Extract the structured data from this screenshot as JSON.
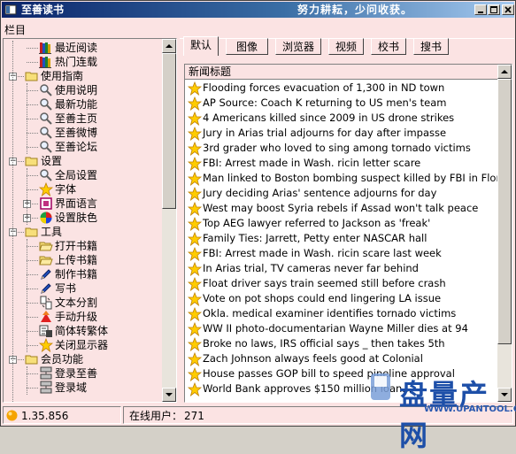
{
  "window": {
    "title": "至善读书",
    "slogan": "努力耕耘，少问收获。",
    "icons": {
      "app": "book-app-icon",
      "minimize": "minimize-icon",
      "maximize": "maximize-icon",
      "close": "close-icon"
    }
  },
  "sidebar": {
    "label": "栏目",
    "items": [
      {
        "label": "最近阅读",
        "icon": "book-stack-icon",
        "level": 1
      },
      {
        "label": "热门连载",
        "icon": "book-stack-icon",
        "level": 1
      },
      {
        "label": "使用指南",
        "icon": "folder-icon",
        "level": 0,
        "expanded": true
      },
      {
        "label": "使用说明",
        "icon": "magnifier-icon",
        "level": 1
      },
      {
        "label": "最新功能",
        "icon": "magnifier-icon",
        "level": 1
      },
      {
        "label": "至善主页",
        "icon": "magnifier-icon",
        "level": 1
      },
      {
        "label": "至善微博",
        "icon": "magnifier-icon",
        "level": 1
      },
      {
        "label": "至善论坛",
        "icon": "magnifier-icon",
        "level": 1
      },
      {
        "label": "设置",
        "icon": "folder-icon",
        "level": 0,
        "expanded": true
      },
      {
        "label": "全局设置",
        "icon": "magnifier-icon",
        "level": 1
      },
      {
        "label": "字体",
        "icon": "star-icon",
        "level": 1
      },
      {
        "label": "界面语言",
        "icon": "frame-icon",
        "level": 1,
        "collapsed": true
      },
      {
        "label": "设置肤色",
        "icon": "color-wheel-icon",
        "level": 1,
        "collapsed": true
      },
      {
        "label": "工具",
        "icon": "folder-icon",
        "level": 0,
        "expanded": true
      },
      {
        "label": "打开书籍",
        "icon": "open-folder-icon",
        "level": 1
      },
      {
        "label": "上传书籍",
        "icon": "open-folder-icon",
        "level": 1
      },
      {
        "label": "制作书籍",
        "icon": "pencil-icon",
        "level": 1
      },
      {
        "label": "写书",
        "icon": "pencil-icon",
        "level": 1
      },
      {
        "label": "文本分割",
        "icon": "split-icon",
        "level": 1
      },
      {
        "label": "手动升级",
        "icon": "upgrade-icon",
        "level": 1
      },
      {
        "label": "简体转繁体",
        "icon": "convert-icon",
        "level": 1
      },
      {
        "label": "关闭显示器",
        "icon": "star-icon",
        "level": 1
      },
      {
        "label": "会员功能",
        "icon": "folder-icon",
        "level": 0,
        "expanded": true
      },
      {
        "label": "登录至善",
        "icon": "network-icon",
        "level": 1
      },
      {
        "label": "登录域",
        "icon": "network-icon",
        "level": 1
      }
    ]
  },
  "tabs": [
    {
      "label": "默认",
      "active": true
    },
    {
      "label": "图像"
    },
    {
      "label": "浏览器"
    },
    {
      "label": "视频"
    },
    {
      "label": "校书"
    },
    {
      "label": "搜书"
    }
  ],
  "news": {
    "header": "新闻标题",
    "icon": "star-icon",
    "items": [
      "Flooding forces evacuation of 1,300 in ND town",
      "AP Source: Coach K returning to US men's team",
      "4 Americans killed since 2009 in US drone strikes",
      "Jury in Arias trial adjourns for day after impasse",
      "3rd grader who loved to sing among tornado victims",
      "FBI: Arrest made in Wash. ricin letter scare",
      "Man linked to Boston bombing suspect killed by FBI in Florida",
      "Jury deciding Arias' sentence adjourns for day",
      "West may boost Syria rebels if Assad won't talk peace",
      "Top AEG lawyer referred to Jackson as 'freak'",
      "Family Ties: Jarrett, Petty enter NASCAR hall",
      "FBI: Arrest made in Wash. ricin scare last week",
      "In Arias trial, TV cameras never far behind",
      "Float driver says train seemed still before crash",
      "Vote on pot shops could end lingering LA issue",
      "Okla. medical examiner identifies tornado victims",
      "WW II photo-documentarian Wayne Miller dies at 94",
      "Broke no laws, IRS official says _ then takes 5th",
      "Zach Johnson always feels good at Colonial",
      "House passes GOP bill to speed pipeline approval",
      "World Bank approves $150 million loan..."
    ]
  },
  "status": {
    "version": "1.35.856",
    "online_label": "在线用户：",
    "online_count": "271",
    "status_icon": "status-orb-icon"
  },
  "watermark": {
    "logo_text": "盘量产网",
    "url": "WWW.UPANTOOL.COM"
  },
  "colors": {
    "panel_bg": "#fbe3e3",
    "title_start": "#0a246a",
    "title_end": "#a6caf0"
  }
}
